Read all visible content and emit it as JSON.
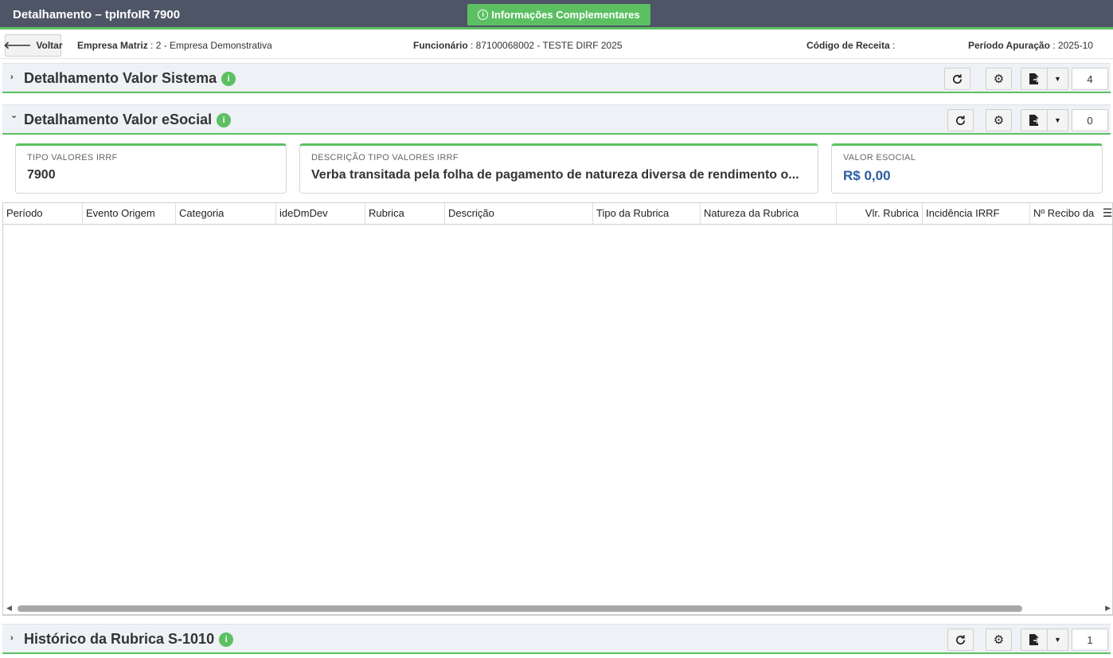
{
  "header": {
    "title": "Detalhamento – tpInfoIR 7900",
    "info_button": "Informações Complementares"
  },
  "infoline": {
    "back_label": "Voltar",
    "empresa_label": "Empresa Matriz",
    "empresa_value": ": 2 - Empresa Demonstrativa",
    "funcionario_label": "Funcionário",
    "funcionario_value": ": 87100068002 - TESTE DIRF 2025",
    "codigo_label": "Código de Receita",
    "codigo_value": ":",
    "periodo_label": "Período Apuração",
    "periodo_value": ": 2025-10"
  },
  "sections": [
    {
      "title": "Detalhamento Valor Sistema",
      "chevron": "›",
      "count": "4",
      "expanded": false
    },
    {
      "title": "Detalhamento Valor eSocial",
      "chevron": "⌄",
      "count": "0",
      "expanded": true
    },
    {
      "title": "Histórico da Rubrica S-1010",
      "chevron": "›",
      "count": "1",
      "expanded": false
    }
  ],
  "cards": {
    "tipo_label": "TIPO VALORES IRRF",
    "tipo_value": "7900",
    "descricao_label": "DESCRIÇÃO TIPO VALORES IRRF",
    "descricao_value": "Verba transitada pela folha de pagamento de natureza diversa de rendimento o...",
    "valor_label": "VALOR ESOCIAL",
    "valor_value": "R$ 0,00"
  },
  "grid": {
    "columns": [
      "Período",
      "Evento Origem",
      "Categoria",
      "ideDmDev",
      "Rubrica",
      "Descrição",
      "Tipo da Rubrica",
      "Natureza da Rubrica",
      "Vlr. Rubrica",
      "Incidência IRRF",
      "Nº Recibo da"
    ]
  },
  "icons": {
    "refresh": "refresh-icon",
    "settings": "gear-icon",
    "export": "export-file-icon",
    "caret": "caret-down-icon",
    "menu": "menu-icon",
    "info": "info-icon"
  },
  "colors": {
    "header_bg": "#4e5566",
    "accent_green": "#5cc062",
    "money_blue": "#2a5d9f"
  }
}
